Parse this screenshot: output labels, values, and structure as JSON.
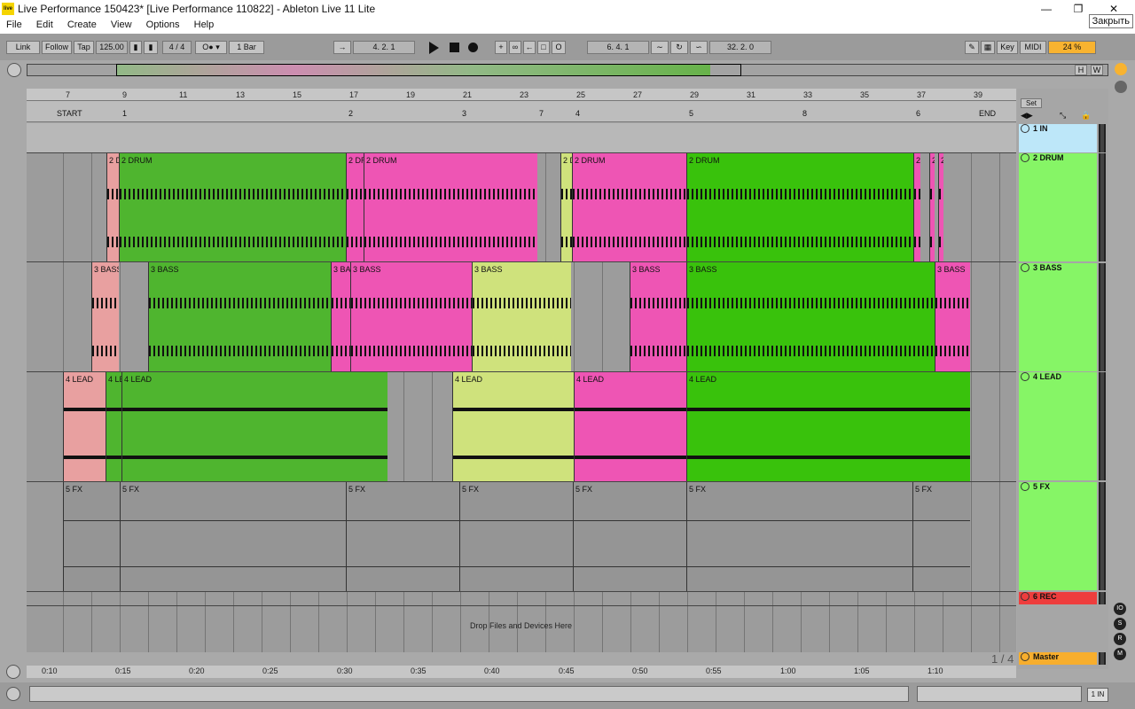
{
  "window": {
    "title": "Live Performance 150423*  [Live Performance 110822] - Ableton Live 11 Lite",
    "logo": "live",
    "tooltip": "Закрыть"
  },
  "menu": [
    "File",
    "Edit",
    "Create",
    "View",
    "Options",
    "Help"
  ],
  "control_bar": {
    "link": "Link",
    "follow": "Follow",
    "tap": "Tap",
    "tempo": "125.00",
    "time_signature": "4 / 4",
    "quantize": "1 Bar",
    "arrangement_position": "4.  2.  1",
    "loop_start": "6.  4.  1",
    "loop_length": "32.  2.  0",
    "key": "Key",
    "midi": "MIDI",
    "cpu": "24 %"
  },
  "overview_buttons": {
    "h": "H",
    "w": "W"
  },
  "ruler": {
    "bars": [
      "7",
      "9",
      "11",
      "13",
      "15",
      "17",
      "19",
      "21",
      "23",
      "25",
      "27",
      "29",
      "31",
      "33",
      "35",
      "37",
      "39"
    ]
  },
  "locators": [
    {
      "label": "START"
    },
    {
      "label": "1"
    },
    {
      "label": "2"
    },
    {
      "label": "3"
    },
    {
      "label": "7"
    },
    {
      "label": "4"
    },
    {
      "label": "5"
    },
    {
      "label": "8"
    },
    {
      "label": "6"
    },
    {
      "label": "END"
    }
  ],
  "set_button": "Set",
  "tracks": [
    {
      "name": "1 IN",
      "color": "#bde7f9",
      "clips": []
    },
    {
      "name": "2 DRUM",
      "color": "#86f566",
      "clips": [
        {
          "title": "2 D",
          "color": "#e8a0a0",
          "start": 90,
          "width": 14
        },
        {
          "title": "2 DRUM",
          "color": "#4fb52f",
          "start": 104,
          "width": 256
        },
        {
          "title": "2 DR",
          "color": "#ee55b4",
          "start": 360,
          "width": 20
        },
        {
          "title": "2 DRUM",
          "color": "#ee55b4",
          "start": 380,
          "width": 196
        },
        {
          "title": "2 D",
          "color": "#cfe27c",
          "start": 602,
          "width": 13
        },
        {
          "title": "2 DRUM",
          "color": "#ee55b4",
          "start": 615,
          "width": 129
        },
        {
          "title": "2 DRUM",
          "color": "#39c20c",
          "start": 744,
          "width": 256
        },
        {
          "title": "2",
          "color": "#ee55b4",
          "start": 1000,
          "width": 8
        },
        {
          "title": "2",
          "color": "#ee55b4",
          "start": 1018,
          "width": 6
        },
        {
          "title": "2",
          "color": "#ee55b4",
          "start": 1028,
          "width": 6
        }
      ]
    },
    {
      "name": "3 BASS",
      "color": "#86f566",
      "clips": [
        {
          "title": "3 BASS",
          "color": "#e8a0a0",
          "start": 73,
          "width": 31
        },
        {
          "title": "3 BASS",
          "color": "#4fb52f",
          "start": 137,
          "width": 206
        },
        {
          "title": "3 BA",
          "color": "#ee55b4",
          "start": 343,
          "width": 22
        },
        {
          "title": "3 BASS",
          "color": "#ee55b4",
          "start": 365,
          "width": 137
        },
        {
          "title": "3 BASS",
          "color": "#cfe27c",
          "start": 502,
          "width": 112
        },
        {
          "title": "3 BASS",
          "color": "#ee55b4",
          "start": 680,
          "width": 64
        },
        {
          "title": "3 BASS",
          "color": "#39c20c",
          "start": 744,
          "width": 280
        },
        {
          "title": "3 BASS",
          "color": "#ee55b4",
          "start": 1024,
          "width": 40
        }
      ]
    },
    {
      "name": "4 LEAD",
      "color": "#86f566",
      "clips": [
        {
          "title": "4 LEAD",
          "color": "#e8a0a0",
          "start": 41,
          "width": 48
        },
        {
          "title": "4 LE",
          "color": "#4fb52f",
          "start": 89,
          "width": 18
        },
        {
          "title": "4 LEAD",
          "color": "#4fb52f",
          "start": 107,
          "width": 300
        },
        {
          "title": "4 LEAD",
          "color": "#cfe27c",
          "start": 480,
          "width": 137
        },
        {
          "title": "4 LEAD",
          "color": "#ee55b4",
          "start": 617,
          "width": 127
        },
        {
          "title": "4 LEAD",
          "color": "#39c20c",
          "start": 744,
          "width": 320
        }
      ]
    },
    {
      "name": "5 FX",
      "color": "#86f566",
      "clips": [
        {
          "title": "5 FX",
          "color": "#959595",
          "start": 41,
          "width": 64
        },
        {
          "title": "5 FX",
          "color": "#959595",
          "start": 105,
          "width": 255
        },
        {
          "title": "5 FX",
          "color": "#959595",
          "start": 360,
          "width": 128
        },
        {
          "title": "5 FX",
          "color": "#959595",
          "start": 488,
          "width": 128
        },
        {
          "title": "5 FX",
          "color": "#959595",
          "start": 616,
          "width": 128
        },
        {
          "title": "5 FX",
          "color": "#959595",
          "start": 744,
          "width": 255
        },
        {
          "title": "5 FX",
          "color": "#959595",
          "start": 999,
          "width": 65
        }
      ]
    },
    {
      "name": "6 REC",
      "color": "#ee3d3d",
      "clips": []
    }
  ],
  "drop_text": "Drop Files and Devices Here",
  "master": {
    "name": "Master",
    "color": "#f7ae2d"
  },
  "page_indicator": "1 / 4",
  "time_ruler": [
    "0:10",
    "0:15",
    "0:20",
    "0:25",
    "0:30",
    "0:35",
    "0:40",
    "0:45",
    "0:50",
    "0:55",
    "1:00",
    "1:05",
    "1:10"
  ],
  "status": {
    "midi_track": "1 IN"
  },
  "icons": [
    "play-icon",
    "stop-icon",
    "record-icon",
    "pencil-icon",
    "keyboard-icon",
    "fold-icon"
  ]
}
